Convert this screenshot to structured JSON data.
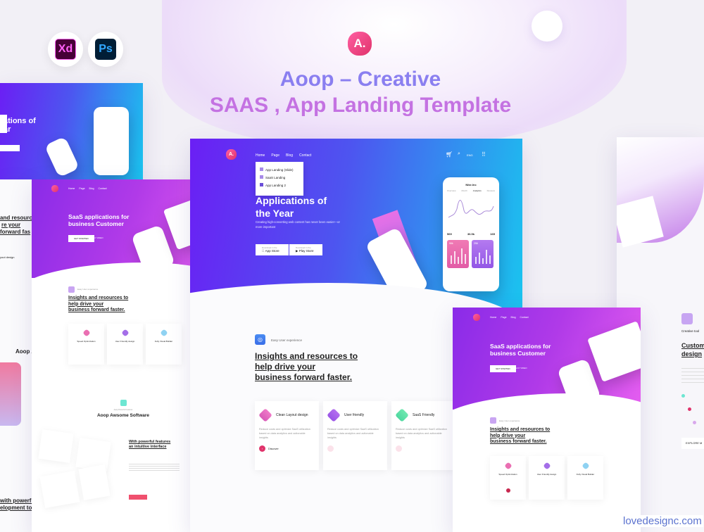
{
  "showcase": {
    "title_line1": "Aoop – Creative",
    "title_line2": "SAAS , App Landing  Template",
    "logo_letter": "A.",
    "tools": [
      "Xd",
      "Ps"
    ],
    "watermark": "lovedesignc.com"
  },
  "colors": {
    "accent_purple": "#8a2be8",
    "accent_blue": "#1ac4ef",
    "accent_pink": "#e0336b",
    "title_blue": "#8a7ff0",
    "title_pink": "#c472e2"
  },
  "main_page": {
    "nav": [
      "Home",
      "Page",
      "Blog",
      "Contact"
    ],
    "lang": "ENG",
    "cart_icon": "cart-icon",
    "search_icon": "search-icon",
    "grid_icon": "grid-icon",
    "dropdown": [
      "App Landing (Slide)",
      "SaaS Landing",
      "App Landing 2"
    ],
    "hero_title_1": "Applications of",
    "hero_title_2": "the Year",
    "hero_sub": "Creating high-converting web content has never been easier—or more important",
    "btn_app_small": "Download in the",
    "btn_app": "App Store",
    "btn_play_small": "Download in the",
    "btn_play": "Play Store",
    "phone": {
      "title": "Nike.Inc",
      "tabs": [
        "Overview",
        "Month",
        "Analytics",
        "Reviews"
      ],
      "stats": [
        {
          "v": "569"
        },
        {
          "v": "36.5k"
        },
        {
          "v": "165"
        }
      ],
      "card1": "96k",
      "card2": "256"
    },
    "section_tag": "Easy User experience",
    "section_title": [
      "Insights and resources to",
      "help drive your",
      "business forward faster."
    ],
    "features": [
      {
        "title": "Clean Layout design",
        "text": "Reduce costs and optimize SaaS utilization based on data analytics and actionable insights",
        "link": "Discover"
      },
      {
        "title": "User friendly",
        "text": "Reduce costs and optimize SaaS utilization based on data analytics and actionable insights"
      },
      {
        "title": "SaaS Friendly",
        "text": "Reduce costs and optimize SaaS utilization based on data analytics and actionable insights"
      }
    ]
  },
  "saas_page": {
    "nav": [
      "Home",
      "Page",
      "Blog",
      "Contact"
    ],
    "hero_title_1": "SaaS applications for",
    "hero_title_2": "business Customer",
    "btn": "GET STARTED",
    "link": "PLAY VIDEO",
    "section_tag": "Easy User experience",
    "section_title": [
      "Insights and resources to",
      "help drive your",
      "business forward faster."
    ],
    "features": [
      "Speed Optimization",
      "User Friendly design",
      "Fully Visual Builder"
    ],
    "software_tag": "Aoop Powerful Features",
    "software_title": "Aoop Awsome Software",
    "feature_title": [
      "With powerful features",
      "an intuitive interface"
    ],
    "cta": "EXPLORE MORE"
  },
  "left_partial": {
    "title_parts": [
      "ations of",
      "ar"
    ],
    "section": [
      "and resources",
      "re your",
      "forward fas"
    ],
    "feature": "yout design",
    "software": "Aoop A",
    "bottom": [
      "with powerful",
      "elopment tools"
    ]
  },
  "right_partial": {
    "tag": "Creative tool",
    "title": [
      "Custom",
      "design"
    ],
    "cta": "EXPLORE M"
  }
}
